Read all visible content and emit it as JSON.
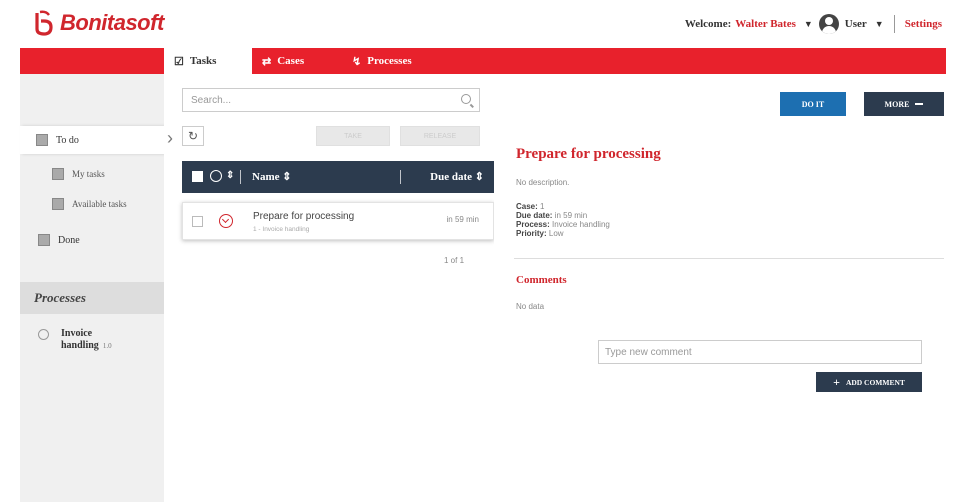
{
  "header": {
    "logo_text": "Bonitasoft",
    "welcome_label": "Welcome:",
    "user_name": "Walter Bates",
    "user_menu": "User",
    "settings": "Settings",
    "brand_color": "#d0262d"
  },
  "nav": {
    "tabs": [
      {
        "label": "Tasks",
        "icon": "check-square-icon",
        "active": true
      },
      {
        "label": "Cases",
        "icon": "cases-icon",
        "active": false
      },
      {
        "label": "Processes",
        "icon": "processes-icon",
        "active": false
      }
    ],
    "accent": "#e8212c"
  },
  "sidebar": {
    "todo": "To do",
    "my_tasks": "My tasks",
    "available_tasks": "Available tasks",
    "done": "Done",
    "processes_header": "Processes",
    "process_name_line1": "Invoice",
    "process_name_line2": "handling",
    "process_version": "1.0"
  },
  "list": {
    "search_placeholder": "Search...",
    "btn_take": "TAKE",
    "btn_release": "RELEASE",
    "col_name": "Name",
    "col_due": "Due date",
    "rows": [
      {
        "name": "Prepare for processing",
        "sub": "1 - Invoice handling",
        "due": "in 59 min"
      }
    ],
    "pager": "1 of 1"
  },
  "detail": {
    "btn_doit": "DO IT",
    "btn_more": "MORE",
    "title": "Prepare for processing",
    "description": "No description.",
    "case_label": "Case:",
    "case_value": "1",
    "due_label": "Due date:",
    "due_value": "in 59 min",
    "process_label": "Process:",
    "process_value": "Invoice handling",
    "priority_label": "Priority:",
    "priority_value": "Low",
    "comments_title": "Comments",
    "no_data": "No data",
    "comment_placeholder": "Type new comment",
    "btn_add_comment": "ADD COMMENT"
  }
}
